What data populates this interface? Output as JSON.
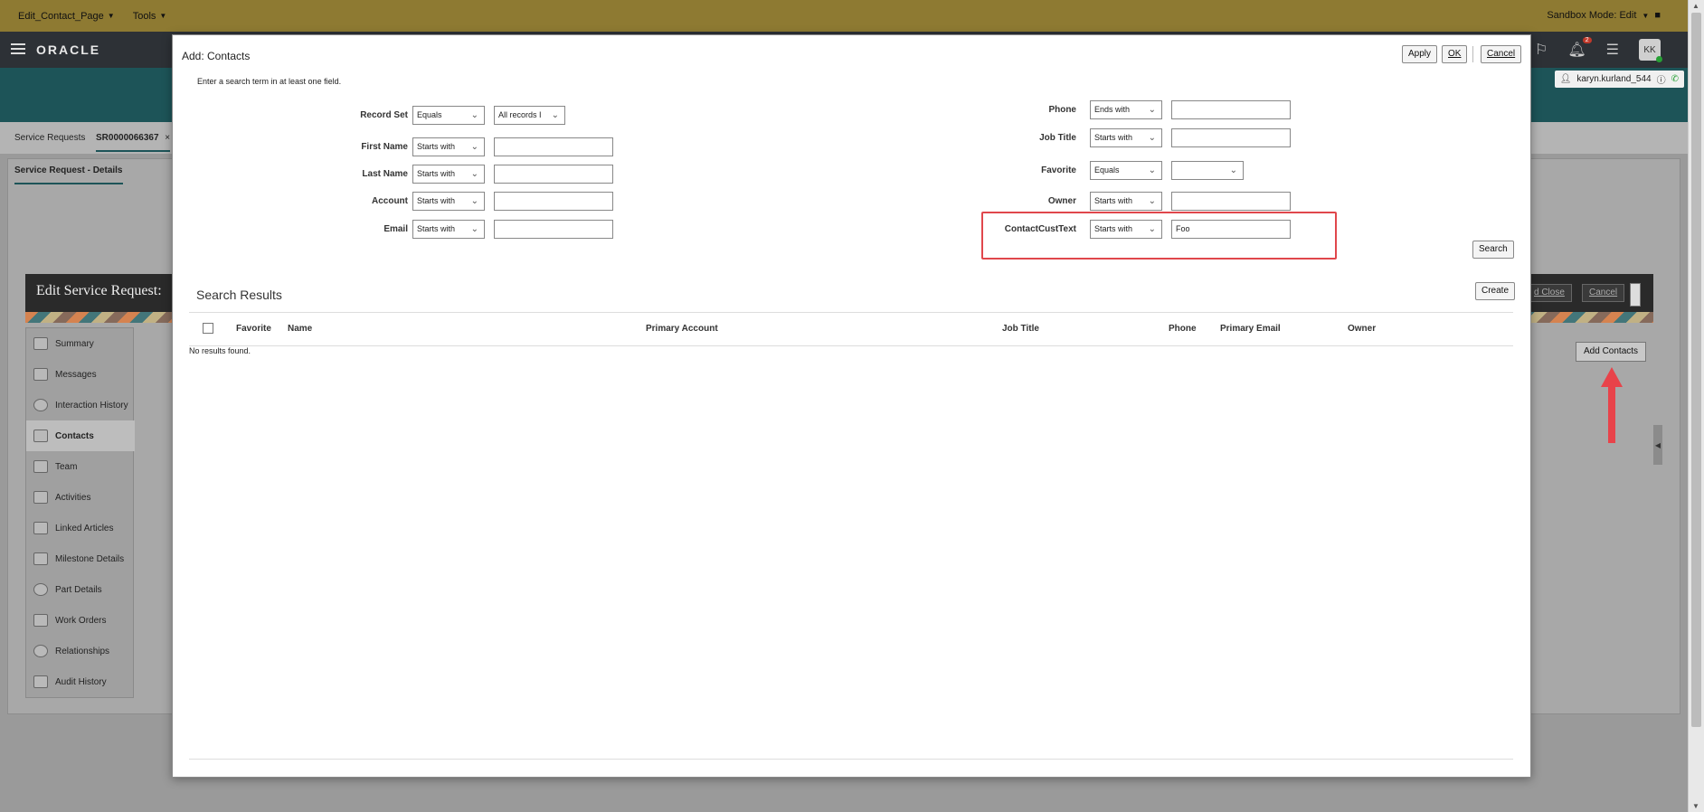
{
  "sandbox_bar": {
    "page_menu": "Edit_Contact_Page",
    "tools_menu": "Tools",
    "sandbox_mode": "Sandbox Mode: Edit"
  },
  "global": {
    "logo": "ORACLE",
    "notifications_count": "2",
    "avatar_initials": "KK",
    "user_name": "karyn.kurland_544"
  },
  "bg_tabs": {
    "service_requests": "Service Requests",
    "sr_number": "SR0000066367",
    "close": "×",
    "subtab": "Service Request - Details"
  },
  "edit_sr": {
    "title": "Edit Service Request:",
    "save_close": "d Close",
    "cancel": "Cancel",
    "add_contacts": "Add Contacts"
  },
  "left_nav": [
    {
      "label": "Summary",
      "icon": "summary-icon"
    },
    {
      "label": "Messages",
      "icon": "messages-icon"
    },
    {
      "label": "Interaction History",
      "icon": "clock-icon"
    },
    {
      "label": "Contacts",
      "icon": "contacts-icon"
    },
    {
      "label": "Team",
      "icon": "team-icon"
    },
    {
      "label": "Activities",
      "icon": "activities-icon"
    },
    {
      "label": "Linked Articles",
      "icon": "linked-articles-icon"
    },
    {
      "label": "Milestone Details",
      "icon": "flag-icon"
    },
    {
      "label": "Part Details",
      "icon": "gears-icon"
    },
    {
      "label": "Work Orders",
      "icon": "truck-icon"
    },
    {
      "label": "Relationships",
      "icon": "network-icon"
    },
    {
      "label": "Audit History",
      "icon": "audit-icon"
    }
  ],
  "dialog": {
    "title": "Add: Contacts",
    "apply": "Apply",
    "ok": "OK",
    "cancel": "Cancel",
    "hint": "Enter a search term in at least one field.",
    "fields_left": [
      {
        "label": "Record Set",
        "operator": "Equals",
        "value": "All records I"
      },
      {
        "label": "First Name",
        "operator": "Starts with",
        "value": ""
      },
      {
        "label": "Last Name",
        "operator": "Starts with",
        "value": ""
      },
      {
        "label": "Account",
        "operator": "Starts with",
        "value": ""
      },
      {
        "label": "Email",
        "operator": "Starts with",
        "value": ""
      }
    ],
    "fields_right": [
      {
        "label": "Phone",
        "operator": "Ends with",
        "value": ""
      },
      {
        "label": "Job Title",
        "operator": "Starts with",
        "value": ""
      },
      {
        "label": "Favorite",
        "operator": "Equals",
        "value": ""
      },
      {
        "label": "Owner",
        "operator": "Starts with",
        "value": ""
      },
      {
        "label": "ContactCustText",
        "operator": "Starts with",
        "value": "Foo"
      }
    ],
    "search": "Search",
    "results_title": "Search Results",
    "create": "Create",
    "columns": [
      "Favorite",
      "Name",
      "Primary Account",
      "Job Title",
      "Phone",
      "Primary Email",
      "Owner"
    ],
    "no_results": "No results found."
  },
  "colors": {
    "sandbox": "#8e7a32",
    "teal": "#1d5458",
    "highlight": "#e0474c",
    "arrow": "#e8434a"
  }
}
